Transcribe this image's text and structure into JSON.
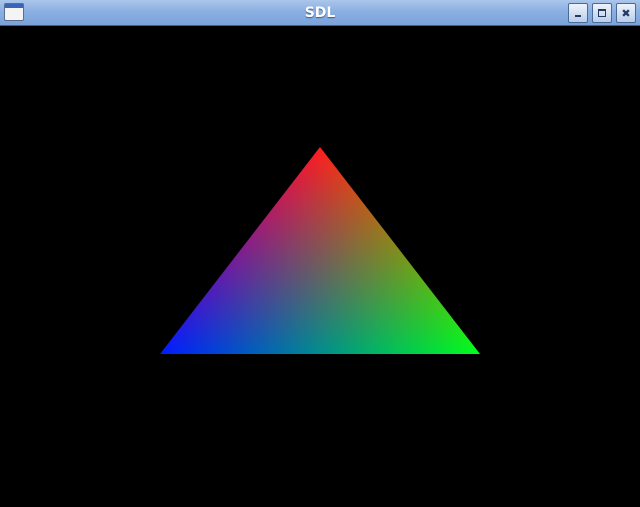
{
  "window": {
    "title": "SDL",
    "icons": {
      "app": "window-icon",
      "minimize": "minimize-icon",
      "maximize": "maximize-icon",
      "close": "close-icon"
    }
  },
  "scene": {
    "background": "#000000",
    "triangle": {
      "vertex_colors": {
        "top": "#ff0000",
        "bottom_left": "#0000ff",
        "bottom_right": "#00ff00"
      }
    }
  }
}
